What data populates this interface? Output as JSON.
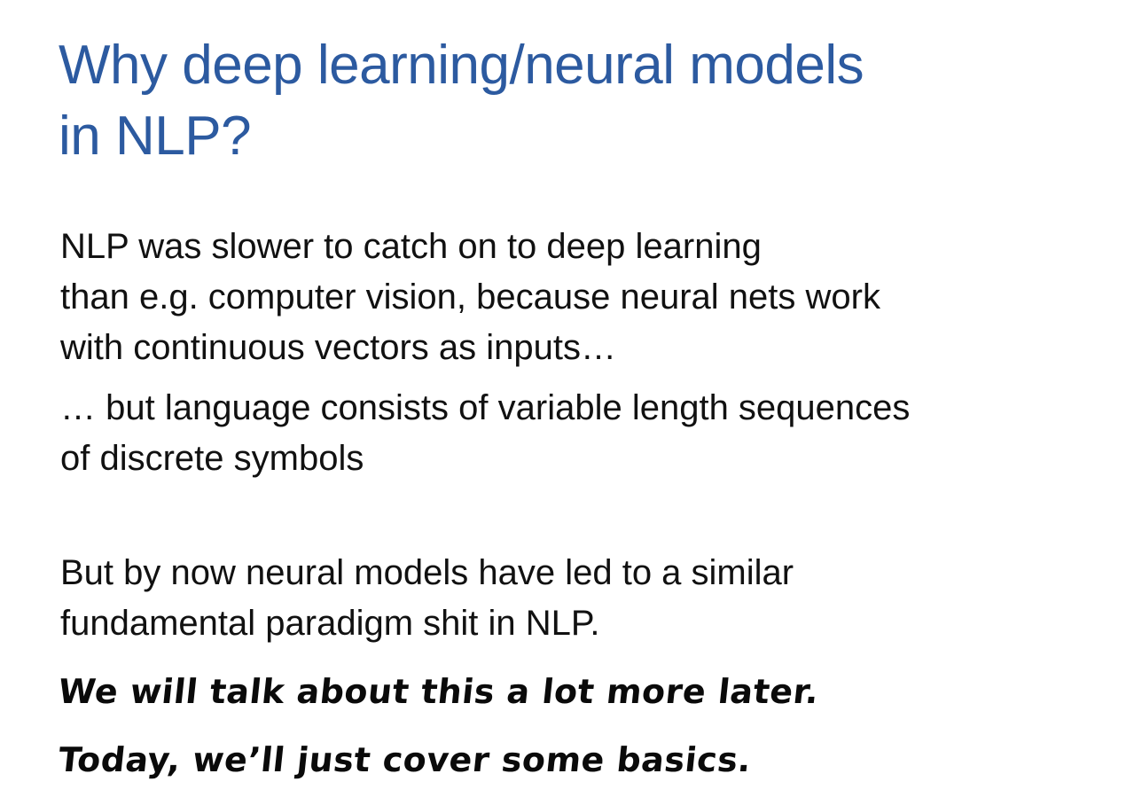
{
  "slide": {
    "title_line1": "Why deep learning/neural models",
    "title_line2": "in NLP?",
    "para1": [
      "NLP was slower to catch on to deep learning",
      "than e.g. computer vision, because neural nets work",
      "with continuous vectors as inputs…"
    ],
    "para2": [
      "… but language consists of variable length sequences",
      "of discrete symbols"
    ],
    "para3": [
      "But by now neural models have led to a similar",
      "fundamental paradigm shit in NLP."
    ],
    "handwritten": [
      "We will talk about this a lot more later.",
      "Today, we’ll just cover some basics."
    ],
    "colors": {
      "title": "#2c5aa0",
      "body": "#111111",
      "background": "#ffffff"
    }
  }
}
